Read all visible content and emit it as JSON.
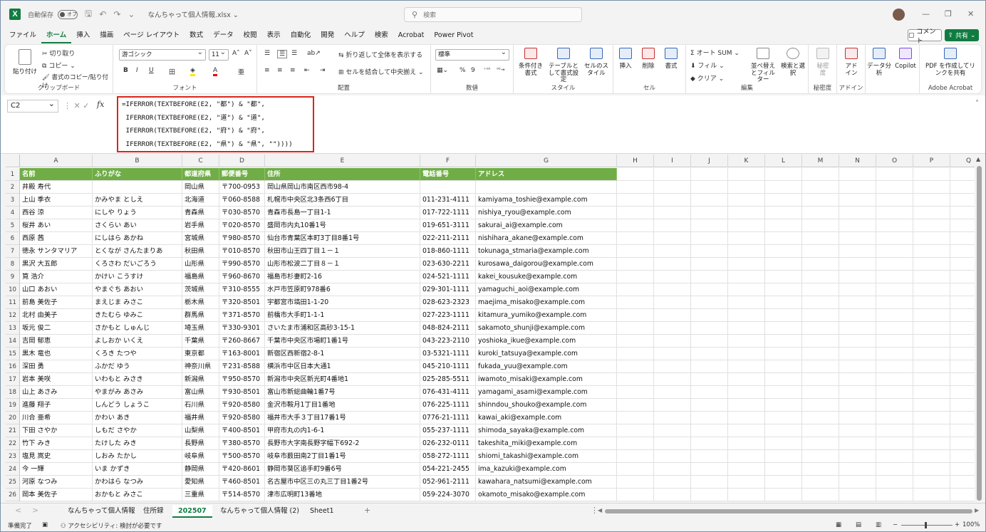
{
  "title": {
    "autosave": "自動保存",
    "toggle": "オフ",
    "filename": "なんちゃって個人情報.xlsx ⌄",
    "search": "検索"
  },
  "menu": [
    "ファイル",
    "ホーム",
    "挿入",
    "描画",
    "ページ レイアウト",
    "数式",
    "データ",
    "校閲",
    "表示",
    "自動化",
    "開発",
    "ヘルプ",
    "検索",
    "Acrobat",
    "Power Pivot"
  ],
  "menu_active": "ホーム",
  "comment": "コメント",
  "share": "共有",
  "ribbon": {
    "paste": "貼り付け",
    "cut": "切り取り",
    "copy": "コピー",
    "format_painter": "書式のコピー/貼り付け",
    "clipboard": "クリップボード",
    "font_name": "游ゴシック",
    "font_size": "11",
    "font": "フォント",
    "wrap": "折り返して全体を表示する",
    "merge": "セルを結合して中央揃え",
    "alignment": "配置",
    "number_format": "標準",
    "number": "数値",
    "cond_format": "条件付き書式",
    "table_format": "テーブルとして書式設定",
    "cell_style": "セルのスタイル",
    "style": "スタイル",
    "insert": "挿入",
    "delete": "削除",
    "format": "書式",
    "cells": "セル",
    "autosum": "オート SUM",
    "fill": "フィル",
    "clear": "クリア",
    "sort": "並べ替えとフィルター",
    "find": "検索と選択",
    "editing": "編集",
    "sensitivity": "秘密度",
    "addin": "アドイン",
    "data_analysis": "データ分析",
    "copilot": "Copilot",
    "pdf": "PDF を作成してリンクを共有",
    "adobe": "Adobe Acrobat"
  },
  "formula_bar": {
    "name_box": "C2",
    "fx": "fx",
    "formula": "=IFERROR(TEXTBEFORE(E2, \"都\") & \"都\",\n IFERROR(TEXTBEFORE(E2, \"道\") & \"道\",\n IFERROR(TEXTBEFORE(E2, \"府\") & \"府\",\n IFERROR(TEXTBEFORE(E2, \"県\") & \"県\", \"\"))))"
  },
  "columns": [
    "A",
    "B",
    "C",
    "D",
    "E",
    "F",
    "G",
    "H",
    "I",
    "J",
    "K",
    "L",
    "M",
    "N",
    "O",
    "P",
    "Q"
  ],
  "headers": [
    "名前",
    "ふりがな",
    "都道府県",
    "郵便番号",
    "住所",
    "電話番号",
    "アドレス"
  ],
  "rows": [
    [
      "井殿 寿代",
      "",
      "岡山県",
      "〒700-0953",
      "岡山県岡山市南区西市98-4",
      "",
      ""
    ],
    [
      "上山 季衣",
      "かみやま としえ",
      "北海道",
      "〒060-8588",
      "札幌市中央区北3条西6丁目",
      "011-231-4111",
      "kamiyama_toshie@example.com"
    ],
    [
      "西谷 涼",
      "にしや りょう",
      "青森県",
      "〒030-8570",
      "青森市長島一丁目1-1",
      "017-722-1111",
      "nishiya_ryou@example.com"
    ],
    [
      "桜井 あい",
      "さくらい あい",
      "岩手県",
      "〒020-8570",
      "盛岡市内丸10番1号",
      "019-651-3111",
      "sakurai_ai@example.com"
    ],
    [
      "西原 茜",
      "にしはら あかね",
      "宮城県",
      "〒980-8570",
      "仙台市青葉区本町3丁目8番1号",
      "022-211-2111",
      "nishihara_akane@example.com"
    ],
    [
      "徳永 サンタマリア",
      "とくなが さんたまりあ",
      "秋田県",
      "〒010-8570",
      "秋田市山王四丁目１－１",
      "018-860-1111",
      "tokunaga_stmaria@example.com"
    ],
    [
      "黒沢 大五郎",
      "くろさわ だいごろう",
      "山形県",
      "〒990-8570",
      "山形市松波二丁目８－１",
      "023-630-2211",
      "kurosawa_daigorou@example.com"
    ],
    [
      "筧 浩介",
      "かけい こうすけ",
      "福島県",
      "〒960-8670",
      "福島市杉妻町2-16",
      "024-521-1111",
      "kakei_kousuke@example.com"
    ],
    [
      "山口 あおい",
      "やまぐち あおい",
      "茨城県",
      "〒310-8555",
      "水戸市笠原町978番6",
      "029-301-1111",
      "yamaguchi_aoi@example.com"
    ],
    [
      "前島 美佐子",
      "まえじま みさこ",
      "栃木県",
      "〒320-8501",
      "宇都宮市塙田1-1-20",
      "028-623-2323",
      "maejima_misako@example.com"
    ],
    [
      "北村 由美子",
      "きたむら ゆみこ",
      "群馬県",
      "〒371-8570",
      "前橋市大手町1-1-1",
      "027-223-1111",
      "kitamura_yumiko@example.com"
    ],
    [
      "坂元 俊二",
      "さかもと しゅんじ",
      "埼玉県",
      "〒330-9301",
      "さいたま市浦和区高砂3-15-1",
      "048-824-2111",
      "sakamoto_shunji@example.com"
    ],
    [
      "吉岡 郁恵",
      "よしおか いくえ",
      "千葉県",
      "〒260-8667",
      "千葉市中央区市場町1番1号",
      "043-223-2110",
      "yoshioka_ikue@example.com"
    ],
    [
      "黒木 竜也",
      "くろき たつや",
      "東京都",
      "〒163-8001",
      "新宿区西新宿2-8-1",
      "03-5321-1111",
      "kuroki_tatsuya@example.com"
    ],
    [
      "深田 勇",
      "ふかだ ゆう",
      "神奈川県",
      "〒231-8588",
      "横浜市中区日本大通1",
      "045-210-1111",
      "fukada_yuu@example.com"
    ],
    [
      "岩本 美咲",
      "いわもと みさき",
      "新潟県",
      "〒950-8570",
      "新潟市中央区新光町4番地1",
      "025-285-5511",
      "iwamoto_misaki@example.com"
    ],
    [
      "山上 あさみ",
      "やまがみ あさみ",
      "富山県",
      "〒930-8501",
      "富山市新総曲輪1番7号",
      "076-431-4111",
      "yamagami_asami@example.com"
    ],
    [
      "進藤 翔子",
      "しんどう しょうこ",
      "石川県",
      "〒920-8580",
      "金沢市鞍月1丁目1番地",
      "076-225-1111",
      "shinndou_shouko@example.com"
    ],
    [
      "川合 亜希",
      "かわい あき",
      "福井県",
      "〒920-8580",
      "福井市大手３丁目17番1号",
      "0776-21-1111",
      "kawai_aki@example.com"
    ],
    [
      "下田 さやか",
      "しもだ さやか",
      "山梨県",
      "〒400-8501",
      "甲府市丸の内1-6-1",
      "055-237-1111",
      "shimoda_sayaka@example.com"
    ],
    [
      "竹下 みき",
      "たけした みき",
      "長野県",
      "〒380-8570",
      "長野市大字南長野字幅下692-2",
      "026-232-0111",
      "takeshita_miki@example.com"
    ],
    [
      "塩見 嵩史",
      "しおみ たかし",
      "岐阜県",
      "〒500-8570",
      "岐阜市薮田南2丁目1番1号",
      "058-272-1111",
      "shiomi_takashi@example.com"
    ],
    [
      "今 一輝",
      "いま かずき",
      "静岡県",
      "〒420-8601",
      "静岡市葵区追手町9番6号",
      "054-221-2455",
      "ima_kazuki@example.com"
    ],
    [
      "河原 なつみ",
      "かわはら なつみ",
      "愛知県",
      "〒460-8501",
      "名古屋市中区三の丸三丁目1番2号",
      "052-961-2111",
      "kawahara_natsumi@example.com"
    ],
    [
      "岡本 美佐子",
      "おかもと みさこ",
      "三重県",
      "〒514-8570",
      "津市広明町13番地",
      "059-224-3070",
      "okamoto_misako@example.com"
    ]
  ],
  "sheet_tabs": [
    "なんちゃって個人情報",
    "住所録",
    "202507",
    "なんちゃって個人情報 (2)",
    "Sheet1"
  ],
  "active_tab": "202507",
  "status": {
    "ready": "準備完了",
    "accessibility": "アクセシビリティ: 検討が必要です",
    "zoom": "100%"
  },
  "colors": {
    "accent": "#107c41",
    "header_fill": "#70ad47",
    "highlight": "#d9251c"
  }
}
